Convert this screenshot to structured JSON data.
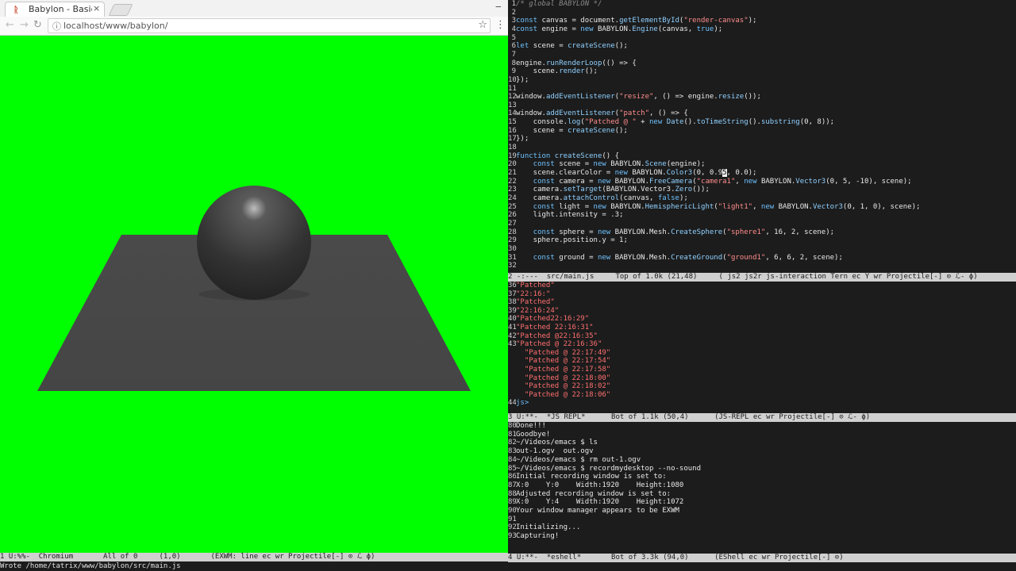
{
  "browser": {
    "tab_title": "Babylon - Basic sc",
    "tab_close": "×",
    "url": "localhost/www/babylon/",
    "scene": {
      "clear_color": "#00ff00",
      "sphere_color": "#333333",
      "ground_color": "#4a4a4a"
    }
  },
  "editor_pane": {
    "lines": [
      {
        "n": "1",
        "segs": [
          [
            "c-cm",
            "/* global BABYLON */"
          ]
        ]
      },
      {
        "n": "2",
        "segs": []
      },
      {
        "n": "3",
        "segs": [
          [
            "c-kw",
            "const "
          ],
          [
            "",
            "canvas = document."
          ],
          [
            "c-fn",
            "getElementById"
          ],
          [
            "",
            "("
          ],
          [
            "c-str",
            "\"render-canvas\""
          ],
          [
            "",
            ");"
          ]
        ]
      },
      {
        "n": "4",
        "segs": [
          [
            "c-kw",
            "const "
          ],
          [
            "",
            "engine = "
          ],
          [
            "c-kw",
            "new "
          ],
          [
            "",
            "BABYLON."
          ],
          [
            "c-fn",
            "Engine"
          ],
          [
            "",
            "(canvas, "
          ],
          [
            "c-kw",
            "true"
          ],
          [
            "",
            ");"
          ]
        ]
      },
      {
        "n": "5",
        "segs": []
      },
      {
        "n": "6",
        "segs": [
          [
            "c-kw",
            "let "
          ],
          [
            "",
            "scene = "
          ],
          [
            "c-fn",
            "createScene"
          ],
          [
            "",
            "();"
          ]
        ]
      },
      {
        "n": "7",
        "segs": []
      },
      {
        "n": "8",
        "segs": [
          [
            "",
            "engine."
          ],
          [
            "c-fn",
            "runRenderLoop"
          ],
          [
            "",
            "(() => {"
          ]
        ]
      },
      {
        "n": "9",
        "segs": [
          [
            "",
            "    scene."
          ],
          [
            "c-fn",
            "render"
          ],
          [
            "",
            "();"
          ]
        ]
      },
      {
        "n": "10",
        "segs": [
          [
            "",
            "});"
          ]
        ]
      },
      {
        "n": "11",
        "segs": []
      },
      {
        "n": "12",
        "segs": [
          [
            "",
            "window."
          ],
          [
            "c-fn",
            "addEventListener"
          ],
          [
            "",
            "("
          ],
          [
            "c-str",
            "\"resize\""
          ],
          [
            "",
            ", () => engine."
          ],
          [
            "c-fn",
            "resize"
          ],
          [
            "",
            "());"
          ]
        ]
      },
      {
        "n": "13",
        "segs": []
      },
      {
        "n": "14",
        "segs": [
          [
            "",
            "window."
          ],
          [
            "c-fn",
            "addEventListener"
          ],
          [
            "",
            "("
          ],
          [
            "c-str",
            "\"patch\""
          ],
          [
            "",
            ", () => {"
          ]
        ]
      },
      {
        "n": "15",
        "segs": [
          [
            "",
            "    console."
          ],
          [
            "c-fn",
            "log"
          ],
          [
            "",
            "("
          ],
          [
            "c-str",
            "\"Patched @ \""
          ],
          [
            "",
            " + "
          ],
          [
            "c-kw",
            "new "
          ],
          [
            "c-fn",
            "Date"
          ],
          [
            "",
            "()."
          ],
          [
            "c-fn",
            "toTimeString"
          ],
          [
            "",
            "()."
          ],
          [
            "c-fn",
            "substring"
          ],
          [
            "",
            "(0, 8));"
          ]
        ]
      },
      {
        "n": "16",
        "segs": [
          [
            "",
            "    scene = "
          ],
          [
            "c-fn",
            "createScene"
          ],
          [
            "",
            "();"
          ]
        ]
      },
      {
        "n": "17",
        "segs": [
          [
            "",
            "});"
          ]
        ]
      },
      {
        "n": "18",
        "segs": []
      },
      {
        "n": "19",
        "segs": [
          [
            "c-kw",
            "function "
          ],
          [
            "c-fn",
            "createScene"
          ],
          [
            "",
            "() {"
          ]
        ]
      },
      {
        "n": "20",
        "segs": [
          [
            "c-kw",
            "    const "
          ],
          [
            "",
            "scene = "
          ],
          [
            "c-kw",
            "new "
          ],
          [
            "",
            "BABYLON."
          ],
          [
            "c-fn",
            "Scene"
          ],
          [
            "",
            "(engine);"
          ]
        ]
      },
      {
        "n": "21",
        "segs": [
          [
            "",
            "    scene.clearColor = "
          ],
          [
            "c-kw",
            "new "
          ],
          [
            "",
            "BABYLON."
          ],
          [
            "c-fn",
            "Color3"
          ],
          [
            "",
            "(0, 0.9"
          ],
          [
            "cursor",
            "5"
          ],
          [
            "",
            ", 0.0);"
          ]
        ]
      },
      {
        "n": "22",
        "segs": [
          [
            "c-kw",
            "    const "
          ],
          [
            "",
            "camera = "
          ],
          [
            "c-kw",
            "new "
          ],
          [
            "",
            "BABYLON."
          ],
          [
            "c-fn",
            "FreeCamera"
          ],
          [
            "",
            "("
          ],
          [
            "c-str",
            "\"camera1\""
          ],
          [
            "",
            ", "
          ],
          [
            "c-kw",
            "new "
          ],
          [
            "",
            "BABYLON."
          ],
          [
            "c-fn",
            "Vector3"
          ],
          [
            "",
            "(0, 5, -10), scene);"
          ]
        ]
      },
      {
        "n": "23",
        "segs": [
          [
            "",
            "    camera."
          ],
          [
            "c-fn",
            "setTarget"
          ],
          [
            "",
            "(BABYLON.Vector3."
          ],
          [
            "c-fn",
            "Zero"
          ],
          [
            "",
            "());"
          ]
        ]
      },
      {
        "n": "24",
        "segs": [
          [
            "",
            "    camera."
          ],
          [
            "c-fn",
            "attachControl"
          ],
          [
            "",
            "(canvas, "
          ],
          [
            "c-kw",
            "false"
          ],
          [
            "",
            ");"
          ]
        ]
      },
      {
        "n": "25",
        "segs": [
          [
            "c-kw",
            "    const "
          ],
          [
            "",
            "light = "
          ],
          [
            "c-kw",
            "new "
          ],
          [
            "",
            "BABYLON."
          ],
          [
            "c-fn",
            "HemisphericLight"
          ],
          [
            "",
            "("
          ],
          [
            "c-str",
            "\"light1\""
          ],
          [
            "",
            ", "
          ],
          [
            "c-kw",
            "new "
          ],
          [
            "",
            "BABYLON."
          ],
          [
            "c-fn",
            "Vector3"
          ],
          [
            "",
            "(0, 1, 0), scene);"
          ]
        ]
      },
      {
        "n": "26",
        "segs": [
          [
            "",
            "    light.intensity = .3;"
          ]
        ]
      },
      {
        "n": "27",
        "segs": []
      },
      {
        "n": "28",
        "segs": [
          [
            "c-kw",
            "    const "
          ],
          [
            "",
            "sphere = "
          ],
          [
            "c-kw",
            "new "
          ],
          [
            "",
            "BABYLON.Mesh."
          ],
          [
            "c-fn",
            "CreateSphere"
          ],
          [
            "",
            "("
          ],
          [
            "c-str",
            "\"sphere1\""
          ],
          [
            "",
            ", 16, 2, scene);"
          ]
        ]
      },
      {
        "n": "29",
        "segs": [
          [
            "",
            "    sphere.position.y = 1;"
          ]
        ]
      },
      {
        "n": "30",
        "segs": []
      },
      {
        "n": "31",
        "segs": [
          [
            "c-kw",
            "    const "
          ],
          [
            "",
            "ground = "
          ],
          [
            "c-kw",
            "new "
          ],
          [
            "",
            "BABYLON.Mesh."
          ],
          [
            "c-fn",
            "CreateGround"
          ],
          [
            "",
            "("
          ],
          [
            "c-str",
            "\"ground1\""
          ],
          [
            "",
            ", 6, 6, 2, scene);"
          ]
        ]
      },
      {
        "n": "32",
        "segs": []
      }
    ],
    "modeline": "2 -:---  src/main.js     Top of 1.0k (21,48)     ( js2 js2r js-interaction Tern ec Y wr Projectile[-] ⊙ ℒ- ϕ)"
  },
  "repl_pane": {
    "lines": [
      {
        "n": "36",
        "text": "\"Patched\""
      },
      {
        "n": "37",
        "text": "\"22:16:\""
      },
      {
        "n": "38",
        "text": "\"Patched\""
      },
      {
        "n": "39",
        "text": "\"22:16:24\""
      },
      {
        "n": "40",
        "text": "\"Patched22:16:29\""
      },
      {
        "n": "41",
        "text": "\"Patched 22:16:31\""
      },
      {
        "n": "42",
        "text": "\"Patched @22:16:35\""
      },
      {
        "n": "43",
        "text": "\"Patched @ 22:16:36\""
      },
      {
        "n": "",
        "text": "  \"Patched @ 22:17:49\""
      },
      {
        "n": "",
        "text": "  \"Patched @ 22:17:54\""
      },
      {
        "n": "",
        "text": "  \"Patched @ 22:17:58\""
      },
      {
        "n": "",
        "text": "  \"Patched @ 22:18:00\""
      },
      {
        "n": "",
        "text": "  \"Patched @ 22:18:02\""
      },
      {
        "n": "",
        "text": "  \"Patched @ 22:18:06\""
      },
      {
        "n": "44",
        "text": "js>"
      }
    ],
    "modeline": "3 U:**-  *JS REPL*      Bot of 1.1k (50,4)      (JS-REPL ec wr Projectile[-] ⊙ ℒ- ϕ)"
  },
  "shell_pane": {
    "lines": [
      {
        "n": "80",
        "text": "Done!!!"
      },
      {
        "n": "81",
        "text": "Goodbye!"
      },
      {
        "n": "82",
        "text": "~/Videos/emacs $ ls"
      },
      {
        "n": "83",
        "text": "out-1.ogv  out.ogv"
      },
      {
        "n": "84",
        "text": "~/Videos/emacs $ rm out-1.ogv"
      },
      {
        "n": "85",
        "text": "~/Videos/emacs $ recordmydesktop --no-sound"
      },
      {
        "n": "86",
        "text": "Initial recording window is set to:"
      },
      {
        "n": "87",
        "text": "X:0    Y:0    Width:1920    Height:1080"
      },
      {
        "n": "88",
        "text": "Adjusted recording window is set to:"
      },
      {
        "n": "89",
        "text": "X:0    Y:4    Width:1920    Height:1072"
      },
      {
        "n": "90",
        "text": "Your window manager appears to be EXWM"
      },
      {
        "n": "91",
        "text": ""
      },
      {
        "n": "92",
        "text": "Initializing..."
      },
      {
        "n": "93",
        "text": "Capturing!"
      }
    ],
    "modeline": "4 U:**-  *eshell*       Bot of 3.3k (94,0)      (EShell ec wr Projectile[-] ⊙)"
  },
  "global_modeline": "1 U:%%-  Chromium       All of 0     (1,0)       (EXWM: line ec wr Projectile[-] ⊙ ℒ ϕ)",
  "minibuffer": "Wrote /home/tatrix/www/babylon/src/main.js"
}
